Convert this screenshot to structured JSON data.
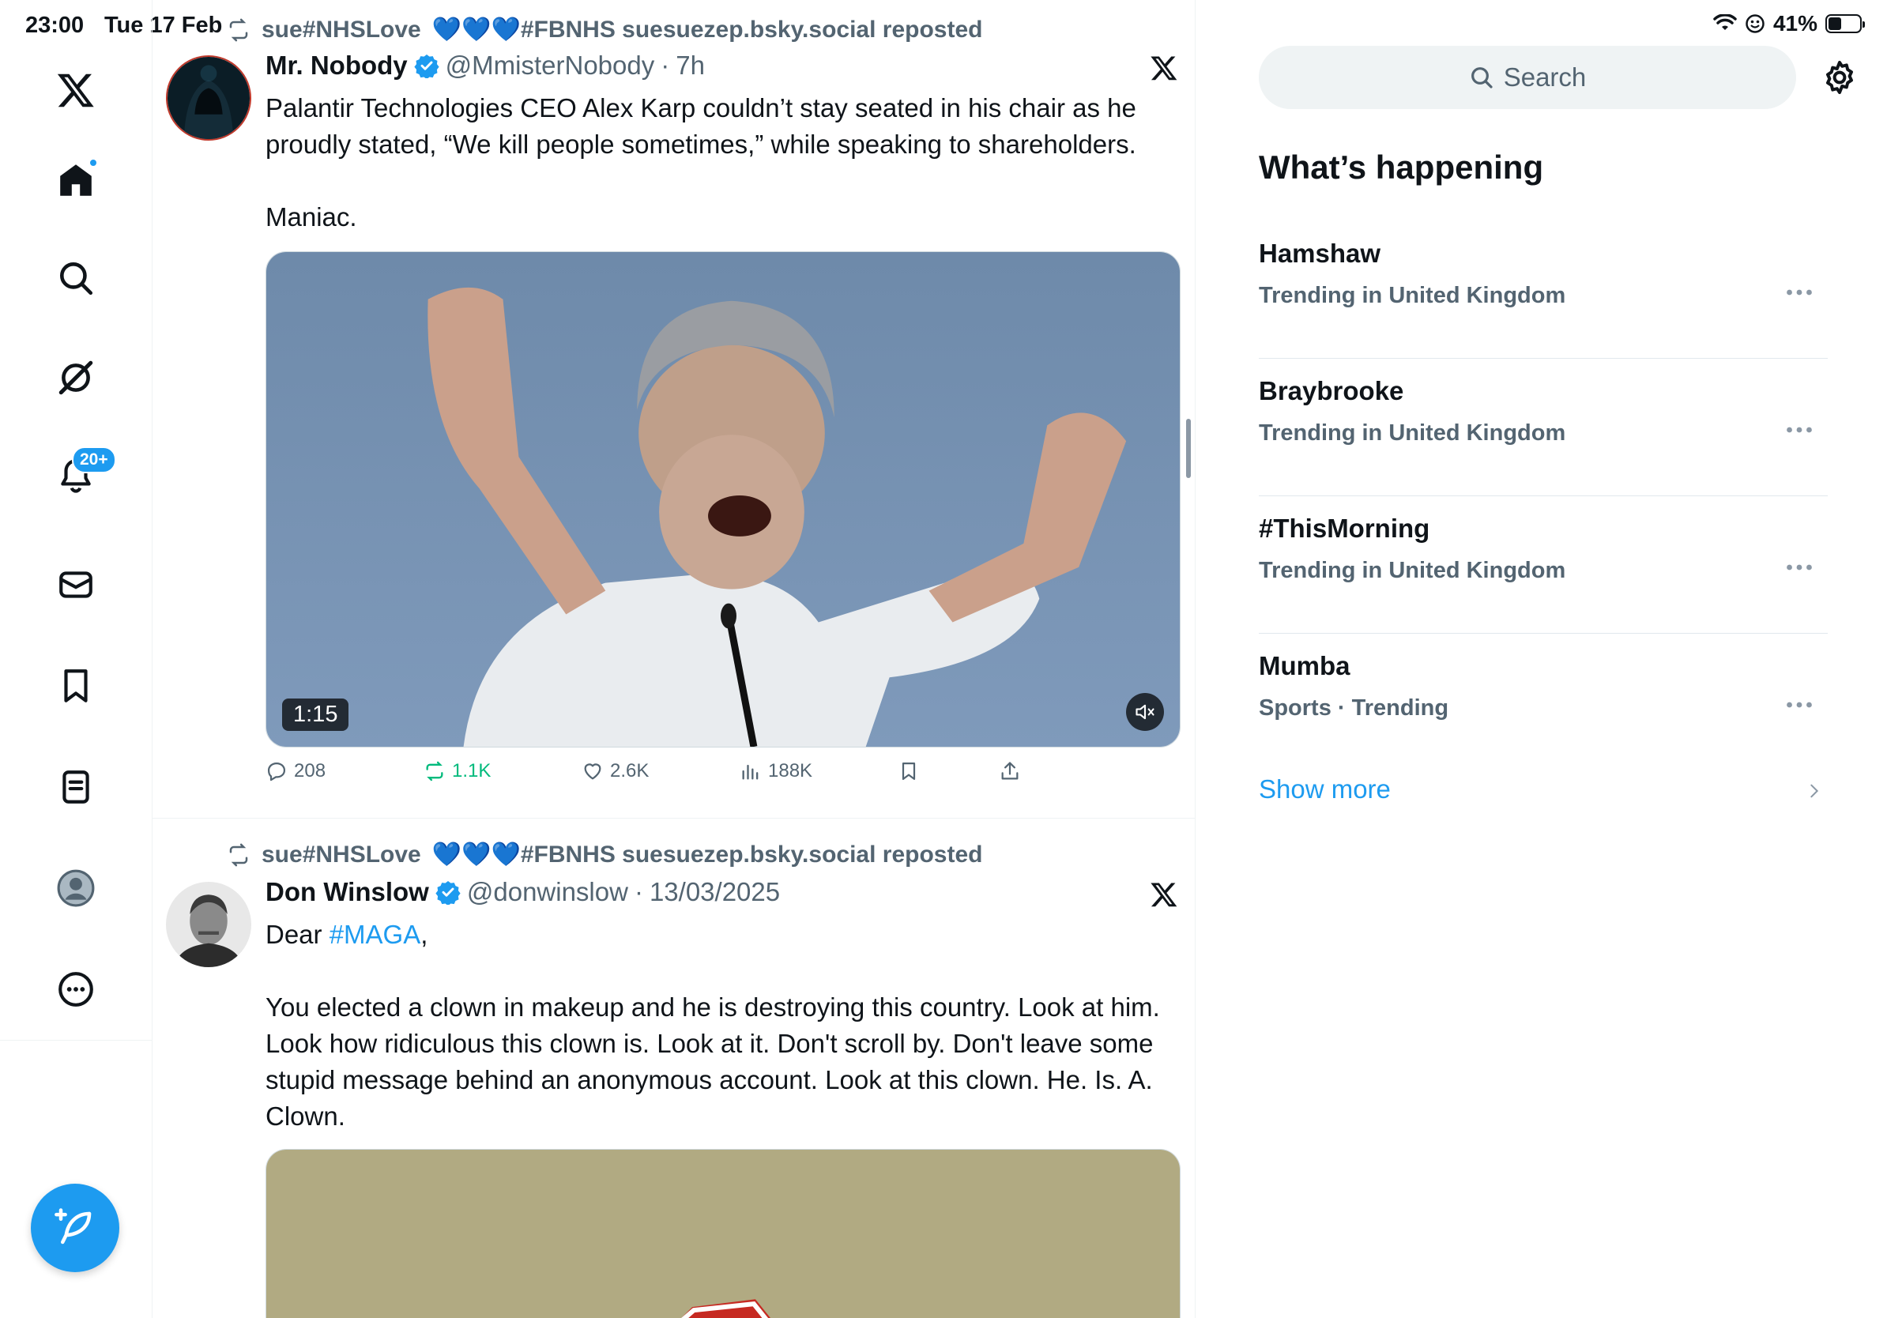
{
  "status_bar": {
    "time": "23:00",
    "date": "Tue 17 Feb",
    "battery": "41%",
    "battery_level": 0.41
  },
  "nav": {
    "notifications_badge": "20+"
  },
  "feed": {
    "posts": [
      {
        "repost_label_prefix": "sue#NHSLove",
        "repost_label_suffix": "#FBNHS suesuezep.bsky.social reposted",
        "author_name": "Mr. Nobody",
        "handle": "@MmisterNobody",
        "time": "7h",
        "text_lines": [
          "Palantir Technologies CEO Alex Karp couldn’t stay seated in his chair as he proudly stated, “We kill people sometimes,” while speaking to shareholders.",
          "Maniac."
        ],
        "video_duration": "1:15",
        "replies": "208",
        "reposts": "1.1K",
        "likes": "2.6K",
        "views": "188K"
      },
      {
        "repost_label_prefix": "sue#NHSLove",
        "repost_label_suffix": "#FBNHS suesuezep.bsky.social reposted",
        "author_name": "Don Winslow",
        "handle": "@donwinslow",
        "time": "13/03/2025",
        "text_first_word": "Dear ",
        "text_hashtag": "#MAGA",
        "text_after_hashtag": ",",
        "text_body": "You elected a clown in makeup and he is destroying this country. Look at him. Look how ridiculous this clown is. Look at it. Don't scroll by. Don't leave some stupid message behind an anonymous account. Look at this clown. He. Is. A. Clown."
      }
    ]
  },
  "right_panel": {
    "search_placeholder": "Search",
    "section_title": "What’s happening",
    "trends": [
      {
        "name": "Hamshaw",
        "meta": "Trending in United Kingdom"
      },
      {
        "name": "Braybrooke",
        "meta": "Trending in United Kingdom"
      },
      {
        "name": "#ThisMorning",
        "meta": "Trending in United Kingdom"
      },
      {
        "name": "Mumba",
        "meta": "Sports · Trending"
      }
    ],
    "show_more": "Show more"
  },
  "colors": {
    "accent": "#1d9bf0",
    "secondary_text": "#536471",
    "repost_green": "#00ba7c"
  }
}
